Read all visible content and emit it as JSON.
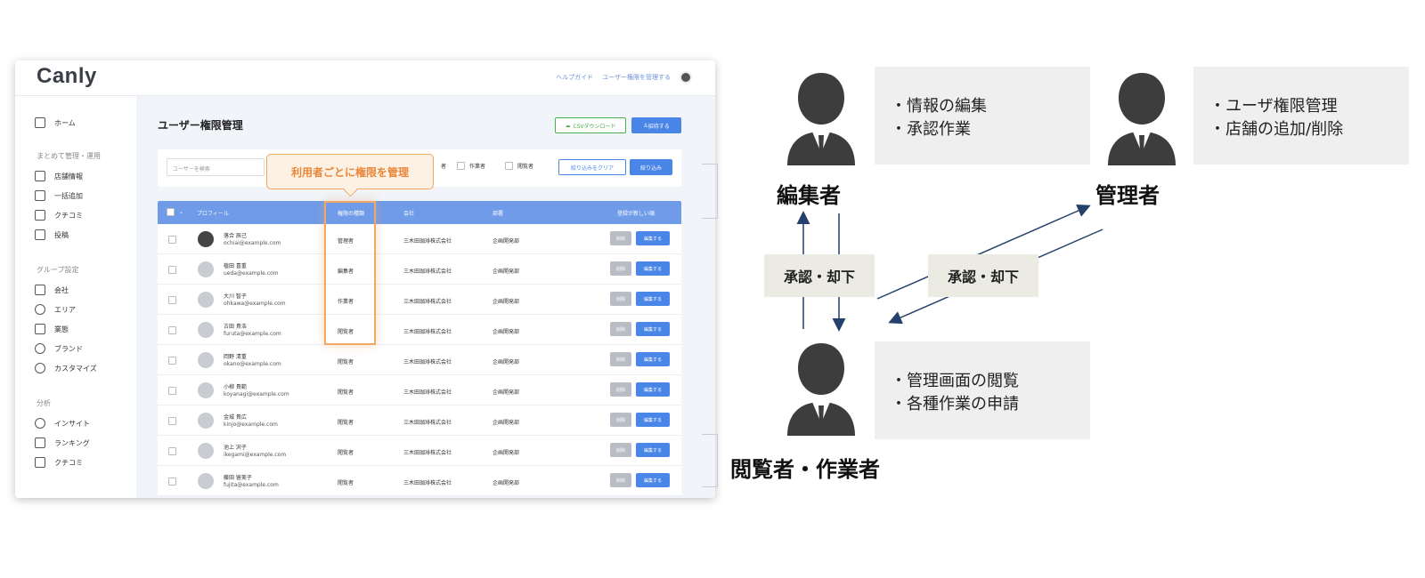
{
  "app": {
    "logo": "Canly",
    "top_links": [
      "ヘルプガイド",
      "ユーザー権限を管理する"
    ],
    "sidebar": {
      "home": "ホーム",
      "group1_title": "まとめて管理・運用",
      "group1": [
        "店舗情報",
        "一括追加",
        "クチコミ",
        "投稿"
      ],
      "group2_title": "グループ設定",
      "group2": [
        "会社",
        "エリア",
        "業態",
        "ブランド",
        "カスタマイズ"
      ],
      "group3_title": "分析",
      "group3": [
        "インサイト",
        "ランキング",
        "クチコミ"
      ]
    },
    "page_title": "ユーザー権限管理",
    "csv_button": "CSVダウンロード",
    "invite_button": "招待する",
    "search_placeholder": "ユーザーを検索",
    "filter_roles": [
      "者",
      "作業者",
      "閲覧者"
    ],
    "clear_button": "絞り込みをクリア",
    "filter_button": "絞り込み",
    "tooltip": "利用者ごとに権限を管理",
    "table_headers": [
      "プロフィール",
      "権限の種類",
      "会社",
      "部署",
      "登録が新しい順"
    ],
    "rows": [
      {
        "name": "落合 辰己",
        "email": "ochiai@example.com",
        "role": "管理者",
        "company": "三木田珈琲株式会社",
        "dept": "企画開発部"
      },
      {
        "name": "植田 喜重",
        "email": "ueda@example.com",
        "role": "編集者",
        "company": "三木田珈琲株式会社",
        "dept": "企画開発部"
      },
      {
        "name": "大川 智子",
        "email": "ohkawa@example.com",
        "role": "作業者",
        "company": "三木田珈琲株式会社",
        "dept": "企画開発部"
      },
      {
        "name": "古田 貴浩",
        "email": "furuta@example.com",
        "role": "閲覧者",
        "company": "三木田珈琲株式会社",
        "dept": "企画開発部"
      },
      {
        "name": "岡野 清重",
        "email": "okano@example.com",
        "role": "閲覧者",
        "company": "三木田珈琲株式会社",
        "dept": "企画開発部"
      },
      {
        "name": "小柳 貴範",
        "email": "koyanagi@example.com",
        "role": "閲覧者",
        "company": "三木田珈琲株式会社",
        "dept": "企画開発部"
      },
      {
        "name": "金城 貴広",
        "email": "kinjo@example.com",
        "role": "閲覧者",
        "company": "三木田珈琲株式会社",
        "dept": "企画開発部"
      },
      {
        "name": "池上 沢子",
        "email": "ikegami@example.com",
        "role": "閲覧者",
        "company": "三木田珈琲株式会社",
        "dept": "企画開発部"
      },
      {
        "name": "藤田 留美子",
        "email": "fujita@example.com",
        "role": "閲覧者",
        "company": "三木田珈琲株式会社",
        "dept": "企画開発部"
      }
    ],
    "delete_label": "削除",
    "edit_label": "編集する"
  },
  "diagram": {
    "editor": {
      "label": "編集者",
      "duties": [
        "・情報の編集",
        "・承認作業"
      ]
    },
    "admin": {
      "label": "管理者",
      "duties": [
        "・ユーザ権限管理",
        "・店舗の追加/削除"
      ]
    },
    "viewer": {
      "label": "閲覧者・作業者",
      "duties": [
        "・管理画面の閲覧",
        "・各種作業の申請"
      ]
    },
    "approve_label_1": "承認・却下",
    "approve_label_2": "承認・却下"
  }
}
